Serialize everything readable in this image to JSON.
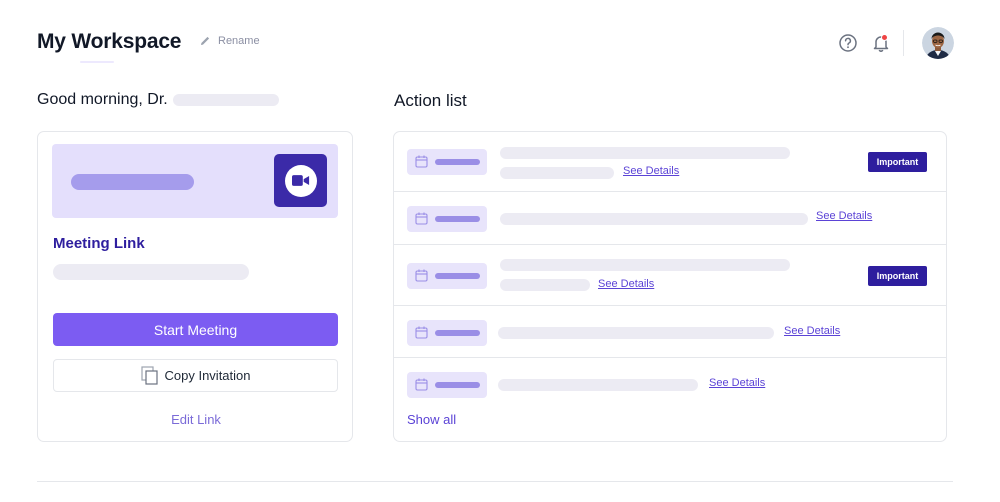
{
  "header": {
    "title": "My Workspace",
    "rename_label": "Rename",
    "icons": [
      "edit-icon",
      "help-icon",
      "bell-icon",
      "avatar"
    ],
    "notification_dot_color": "#ef4444"
  },
  "greeting": {
    "text": "Good morning, Dr."
  },
  "meeting_card": {
    "title": "Meeting Link",
    "start_button": "Start Meeting",
    "copy_button": "Copy Invitation",
    "edit_link": "Edit Link",
    "banner_icon": "video-camera-icon"
  },
  "action_list": {
    "title": "Action list",
    "see_details_label": "See Details",
    "important_label": "Important",
    "show_all_label": "Show all",
    "rows": [
      {
        "important": true
      },
      {
        "important": false
      },
      {
        "important": true
      },
      {
        "important": false
      },
      {
        "important": false
      }
    ]
  },
  "colors": {
    "accent": "#7c5cf2",
    "brand_dark": "#2e1e9e",
    "banner_bg": "#e4dffc",
    "skeleton": "#ecebf3"
  }
}
